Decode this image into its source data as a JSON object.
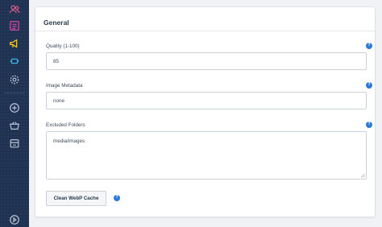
{
  "sidebar": {
    "icons": [
      "users-icon",
      "list-icon",
      "megaphone-icon",
      "plugin-icon",
      "gear-icon",
      "plus-circle-icon",
      "basket-icon",
      "store-icon",
      "play-circle-icon"
    ],
    "colors": {
      "background": "#1f3252",
      "users": "#e05a8a",
      "list": "#d04aa8",
      "megaphone": "#f2c12e",
      "plugin": "#2fb5e8",
      "neutral": "#b7c2d2"
    }
  },
  "card": {
    "title": "General",
    "quality": {
      "label": "Quality (1-100)",
      "value": "85",
      "help": "?"
    },
    "metadata": {
      "label": "Image Metadata",
      "value": "none",
      "help": "?"
    },
    "excluded": {
      "label": "Excluded Folders",
      "value": "media/images",
      "help": "?"
    },
    "clear_button": {
      "label": "Clean WebP Cache",
      "help": "?"
    }
  },
  "accent_color": "#2c7ad6"
}
